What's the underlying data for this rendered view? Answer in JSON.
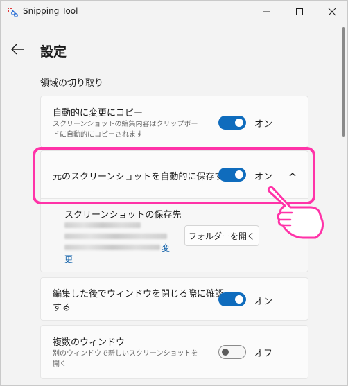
{
  "window": {
    "title": "Snipping Tool",
    "icons": [
      "snipping-tool-icon",
      "minimize-icon",
      "maximize-icon",
      "close-icon"
    ]
  },
  "header": {
    "title": "設定"
  },
  "section": {
    "title": "領域の切り取り"
  },
  "settings": [
    {
      "title": "自動的に変更にコピー",
      "subtitle_line1": "スクリーンショットの編集内容はクリップボー",
      "subtitle_line2": "ドに自動的にコピーされます",
      "state": "オン"
    },
    {
      "title": "元のスクリーンショットを自動的に保存する",
      "state": "オン",
      "expanded": true
    },
    {
      "title_line1": "編集した後でウィンドウを閉じる際に確認",
      "title_line2": "する",
      "state": "オン"
    },
    {
      "title": "複数のウィンドウ",
      "subtitle_line1": "別のウィンドウで新しいスクリーンショットを",
      "subtitle_line2": "開く",
      "state": "オフ"
    }
  ],
  "save_location": {
    "title": "スクリーンショットの保存先",
    "change_link_line1": "変",
    "change_link_line2": "更",
    "open_folder_button": "フォルダーを開く"
  },
  "colors": {
    "accent": "#0f6cbd",
    "highlight": "#ff33a8",
    "background": "#f3f3f3",
    "card": "#fbfbfb"
  }
}
